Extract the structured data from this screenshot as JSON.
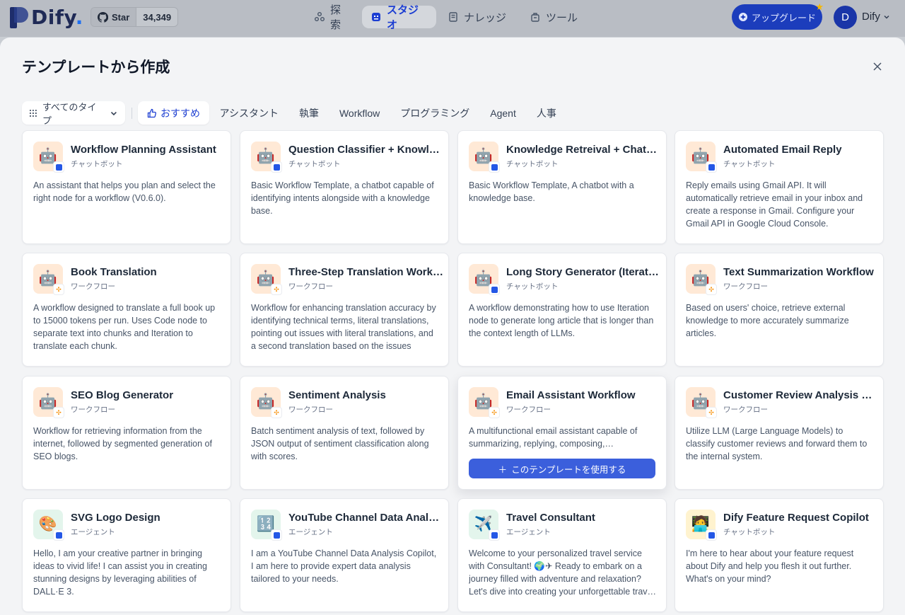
{
  "app": {
    "logo_text": "Dify",
    "logo_dot": ".",
    "star_label": "Star",
    "star_count": "34,349"
  },
  "nav": [
    {
      "label": "探索",
      "icon": "explore-icon"
    },
    {
      "label": "スタジオ",
      "icon": "studio-icon",
      "active": true
    },
    {
      "label": "ナレッジ",
      "icon": "knowledge-icon"
    },
    {
      "label": "ツール",
      "icon": "tools-icon"
    }
  ],
  "upgrade_label": "アップグレード",
  "user": {
    "initial": "D",
    "name": "Dify"
  },
  "modal": {
    "title": "テンプレートから作成",
    "type_select": "すべてのタイプ",
    "tabs": [
      "おすすめ",
      "アシスタント",
      "執筆",
      "Workflow",
      "プログラミング",
      "Agent",
      "人事"
    ],
    "use_button": "このテンプレートを使用する"
  },
  "templates": [
    {
      "title": "Workflow Planning Assistant",
      "type": "チャットボット",
      "desc": "An assistant that helps you plan and select the right node for a workflow (V0.6.0).",
      "icon": "🤖",
      "badge": "chatbot"
    },
    {
      "title": "Question Classifier + Knowledge + Chatbot",
      "type": "チャットボット",
      "desc": "Basic Workflow Template, a chatbot capable of identifying intents alongside with a knowledge base.",
      "icon": "🤖",
      "badge": "chatbot"
    },
    {
      "title": "Knowledge Retreival + Chatbot",
      "type": "チャットボット",
      "desc": "Basic Workflow Template, A chatbot with a knowledge base.",
      "icon": "🤖",
      "badge": "chatbot"
    },
    {
      "title": "Automated Email Reply",
      "type": "チャットボット",
      "desc": "Reply emails using Gmail API. It will automatically retrieve email in your inbox and create a response in Gmail. Configure your Gmail API in Google Cloud Console.",
      "icon": "🤖",
      "badge": "chatbot"
    },
    {
      "title": "Book Translation",
      "type": "ワークフロー",
      "desc": "A workflow designed to translate a full book up to 15000 tokens per run. Uses Code node to separate text into chunks and Iteration to translate each chunk.",
      "icon": "🤖",
      "badge": "workflow"
    },
    {
      "title": "Three-Step Translation Workflow",
      "type": "ワークフロー",
      "desc": "Workflow for enhancing translation accuracy by identifying technical terms, literal translations, pointing out issues with literal translations, and a second translation based on the issues",
      "icon": "🤖",
      "badge": "workflow"
    },
    {
      "title": "Long Story Generator (Iteration)",
      "type": "チャットボット",
      "desc": "A workflow demonstrating how to use Iteration node to generate long article that is longer than the context length of LLMs.",
      "icon": "🤖",
      "badge": "chatbot"
    },
    {
      "title": "Text Summarization Workflow",
      "type": "ワークフロー",
      "desc": "Based on users' choice, retrieve external knowledge to more accurately summarize articles.",
      "icon": "🤖",
      "badge": "workflow"
    },
    {
      "title": "SEO Blog Generator",
      "type": "ワークフロー",
      "desc": "Workflow for retrieving information from the internet, followed by segmented generation of SEO blogs.",
      "icon": "🤖",
      "badge": "workflow"
    },
    {
      "title": "Sentiment Analysis",
      "type": "ワークフロー",
      "desc": "Batch sentiment analysis of text, followed by JSON output of sentiment classification along with scores.",
      "icon": "🤖",
      "badge": "workflow"
    },
    {
      "title": "Email Assistant Workflow",
      "type": "ワークフロー",
      "desc": "A multifunctional email assistant capable of summarizing, replying, composing, proofreading, and checking grammar.",
      "icon": "🤖",
      "badge": "workflow",
      "hover": true
    },
    {
      "title": "Customer Review Analysis Workflow",
      "type": "ワークフロー",
      "desc": "Utilize LLM (Large Language Models) to classify customer reviews and forward them to the internal system.",
      "icon": "🤖",
      "badge": "workflow"
    },
    {
      "title": "SVG Logo Design",
      "type": "エージェント",
      "desc": "Hello, I am your creative partner in bringing ideas to vivid life! I can assist you in creating stunning designs by leveraging abilities of DALL·E 3.",
      "icon": "🎨",
      "badge": "chatbot",
      "bg": "green"
    },
    {
      "title": "YouTube Channel Data Analysis",
      "type": "エージェント",
      "desc": "I am a YouTube Channel Data Analysis Copilot, I am here to provide expert data analysis tailored to your needs.",
      "icon": "🔢",
      "badge": "chatbot",
      "bg": "green"
    },
    {
      "title": "Travel Consultant",
      "type": "エージェント",
      "desc": "Welcome to your personalized travel service with Consultant! 🌍✈ Ready to embark on a journey filled with adventure and relaxation? Let's dive into creating your unforgettable travel experience.",
      "icon": "✈️",
      "badge": "chatbot",
      "bg": "green"
    },
    {
      "title": "Dify Feature Request Copilot",
      "type": "チャットボット",
      "desc": "I'm here to hear about your feature request about Dify and help you flesh it out further. What's on your mind?",
      "icon": "🧑‍💻",
      "badge": "chatbot",
      "bg": "yellow"
    }
  ]
}
